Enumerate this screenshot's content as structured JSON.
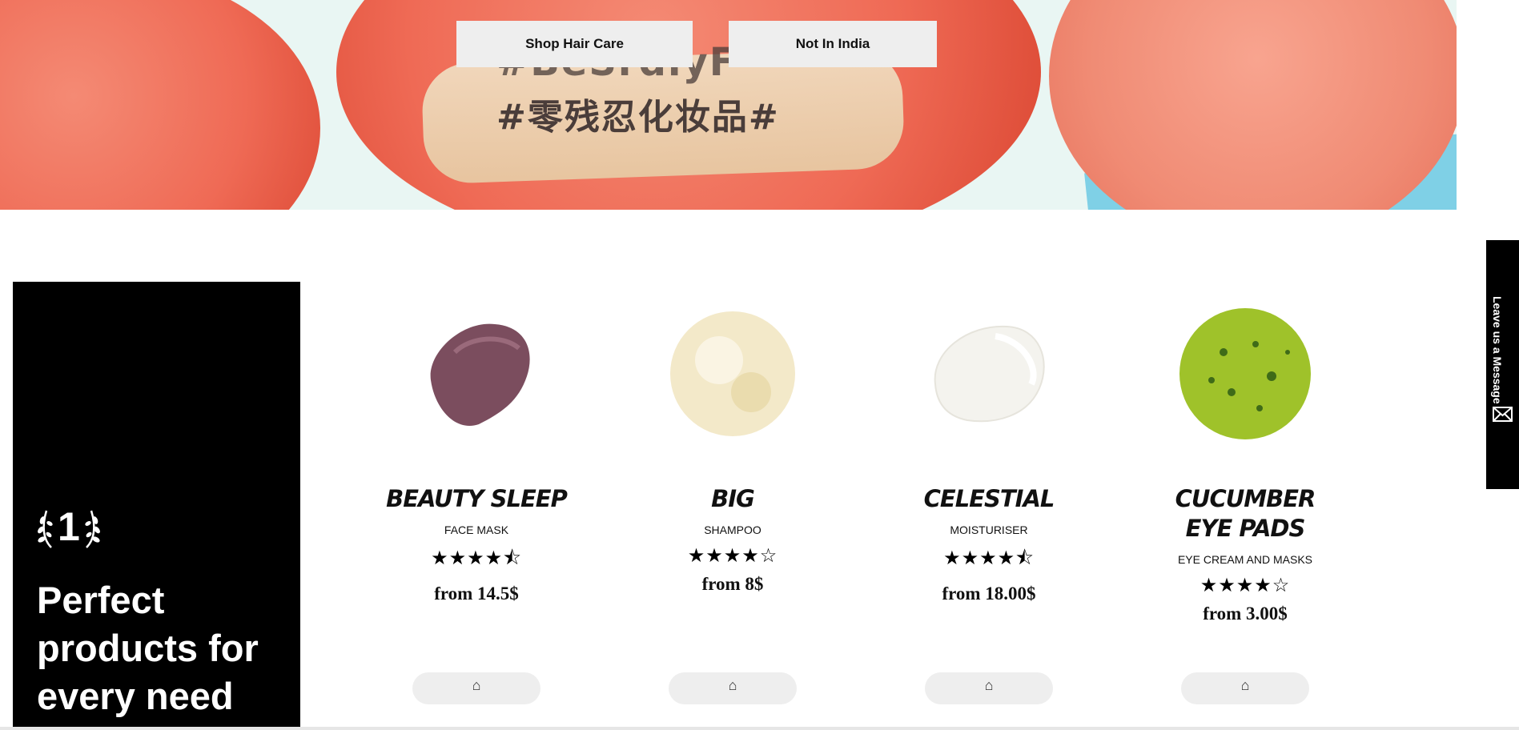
{
  "hero": {
    "buttons": {
      "shop_hair_care": "Shop Hair Care",
      "not_in_india": "Not In India"
    },
    "image_text": {
      "line1": "#BeSrdlyF",
      "line2": "#零残忍化妆品#"
    }
  },
  "feature": {
    "rank": "1",
    "title": "Perfect products for every need"
  },
  "products": [
    {
      "name": "BEAUTY SLEEP",
      "category": "FACE MASK",
      "stars": "★★★★⯪",
      "price": "from 14.5$",
      "color": "#7b4d5e"
    },
    {
      "name": "BIG",
      "category": "SHAMPOO",
      "stars": "★★★★☆",
      "price": "from 8$",
      "color": "#f3e9c9"
    },
    {
      "name": "CELESTIAL",
      "category": "MOISTURISER",
      "stars": "★★★★⯪",
      "price": "from 18.00$",
      "color": "#f7f6f1"
    },
    {
      "name": "CUCUMBER EYE PADS",
      "category": "EYE CREAM AND MASKS",
      "stars": "★★★★☆",
      "price": "from 3.00$",
      "color": "#9fc22a"
    }
  ],
  "feedback": {
    "label": "Leave us a Message"
  }
}
